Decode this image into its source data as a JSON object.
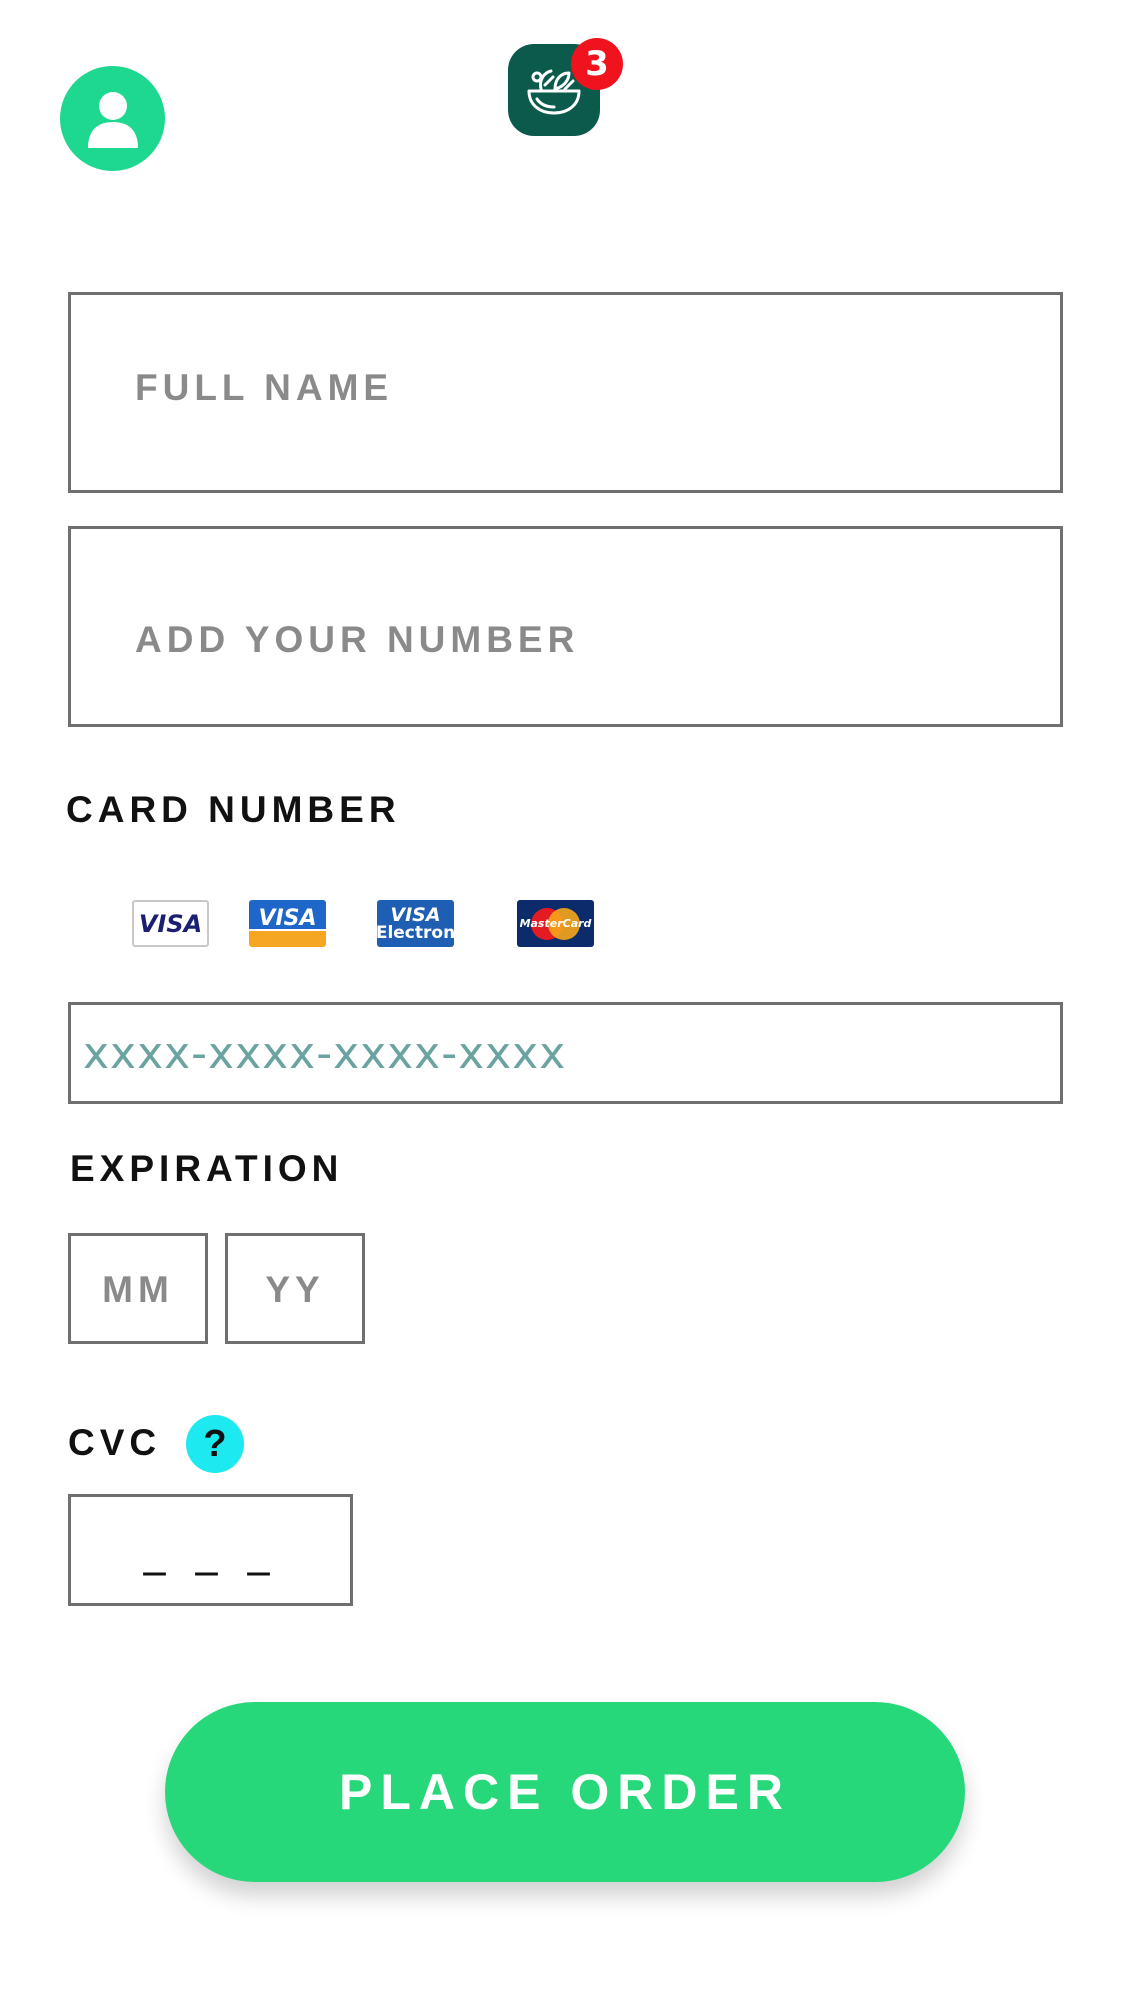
{
  "header": {
    "avatar_icon": "user-icon",
    "app_icon": "salad-bowl-icon",
    "cart_count": "3"
  },
  "form": {
    "full_name_placeholder": "FULL NAME",
    "phone_placeholder": "ADD YOUR NUMBER",
    "card_number_label": "CARD NUMBER",
    "card_logos": {
      "visa": "VISA",
      "visa_alt": "VISA",
      "visa_electron_top": "VISA",
      "visa_electron_bottom": "Electron",
      "mastercard": "MasterCard"
    },
    "card_number_placeholder": "xxxx-xxxx-xxxx-xxxx",
    "expiration_label": "EXPIRATION",
    "month_placeholder": "MM",
    "year_placeholder": "YY",
    "cvc_label": "CVC",
    "cvc_help": "?",
    "cvc_placeholder": "_ _ _"
  },
  "actions": {
    "place_order": "PLACE ORDER"
  },
  "colors": {
    "accent_green": "#26d879",
    "avatar_green": "#1fd88f",
    "app_icon_bg": "#0b5a4c",
    "badge_red": "#f0131e",
    "help_cyan": "#1de9f0"
  }
}
